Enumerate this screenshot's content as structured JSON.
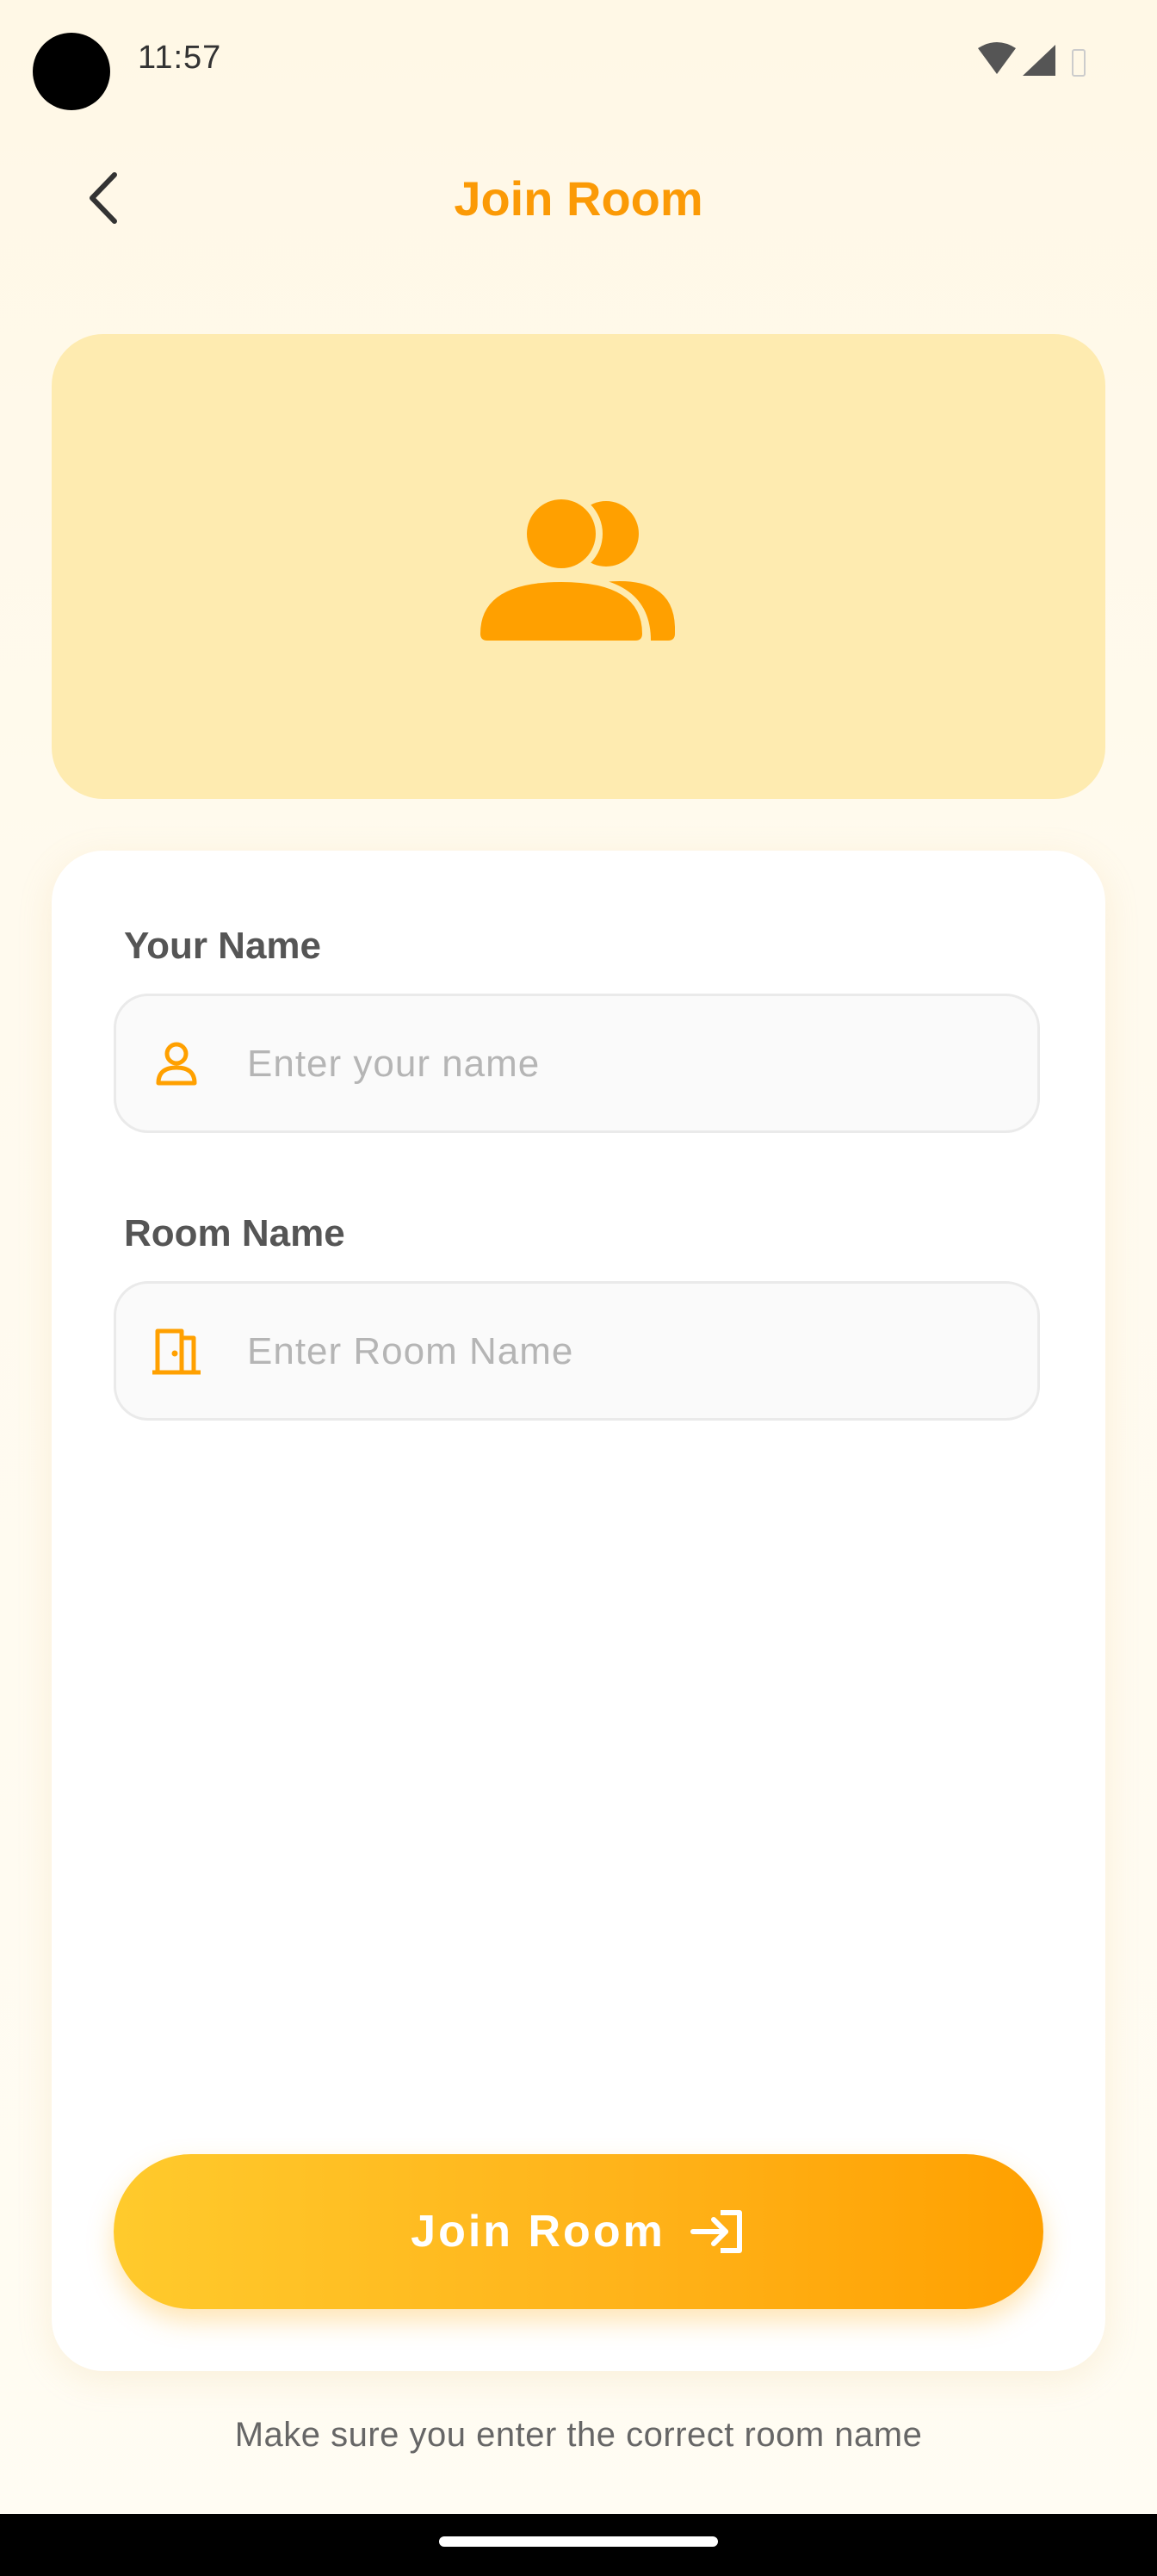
{
  "status_bar": {
    "time": "11:57",
    "icons": [
      "wifi-icon",
      "signal-icon",
      "battery-icon"
    ]
  },
  "header": {
    "title": "Join Room",
    "back_icon": "chevron-left-icon"
  },
  "hero": {
    "icon": "users-icon"
  },
  "form": {
    "name_field": {
      "label": "Your Name",
      "value": "",
      "placeholder": "Enter your name",
      "icon": "person-icon"
    },
    "room_field": {
      "label": "Room Name",
      "value": "",
      "placeholder": "Enter Room Name",
      "icon": "door-icon"
    },
    "submit": {
      "label": "Join Room",
      "icon": "login-arrow-icon"
    }
  },
  "hint": "Make sure you enter the correct room name",
  "colors": {
    "accent": "#FB9A06",
    "hero_background": "#FEEBB0",
    "button_gradient_start": "#FFCA2C",
    "button_gradient_end": "#FFA000"
  }
}
